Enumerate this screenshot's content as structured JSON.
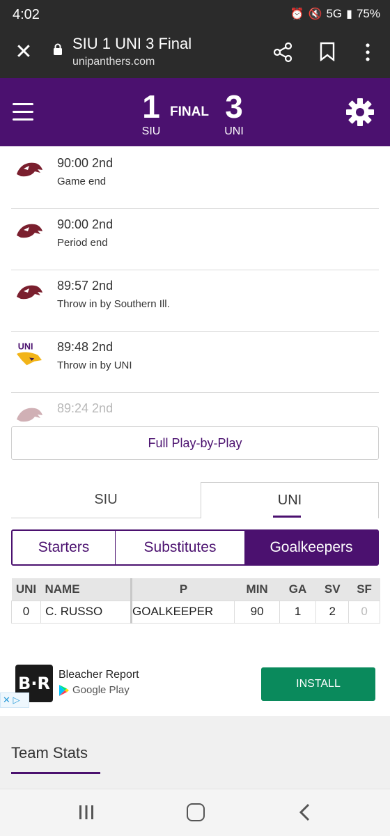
{
  "status_bar": {
    "time": "4:02",
    "network": "5G",
    "battery": "75%"
  },
  "browser": {
    "title": "SIU 1 UNI 3 Final",
    "domain": "unipanthers.com"
  },
  "score": {
    "home_score": "1",
    "home_abbr": "SIU",
    "status": "FINAL",
    "away_score": "3",
    "away_abbr": "UNI"
  },
  "play_by_play": [
    {
      "team": "SIU",
      "time": "90:00 2nd",
      "description": "Game end"
    },
    {
      "team": "SIU",
      "time": "90:00 2nd",
      "description": "Period end"
    },
    {
      "team": "SIU",
      "time": "89:57 2nd",
      "description": "Throw in by Southern Ill."
    },
    {
      "team": "UNI",
      "time": "89:48 2nd",
      "description": "Throw in by UNI"
    },
    {
      "team": "SIU",
      "time": "89:24 2nd",
      "description": ""
    }
  ],
  "full_pbp_label": "Full Play-by-Play",
  "team_tabs": {
    "siu": "SIU",
    "uni": "UNI"
  },
  "segments": {
    "starters": "Starters",
    "substitutes": "Substitutes",
    "goalkeepers": "Goalkeepers"
  },
  "table": {
    "headers": [
      "UNI",
      "NAME",
      "P",
      "MIN",
      "GA",
      "SV",
      "SF"
    ],
    "rows": [
      {
        "number": "0",
        "name": "C. RUSSO",
        "pos": "GOALKEEPER",
        "min": "90",
        "ga": "1",
        "sv": "2",
        "sf": "0"
      }
    ]
  },
  "ad": {
    "logo": "B·R",
    "title": "Bleacher Report",
    "store": "Google Play",
    "install": "INSTALL"
  },
  "team_stats_title": "Team Stats",
  "colors": {
    "brand_purple": "#4b116f",
    "install_green": "#0a8a5c",
    "siu_maroon": "#7a1f2e",
    "uni_gold": "#f2b418"
  }
}
